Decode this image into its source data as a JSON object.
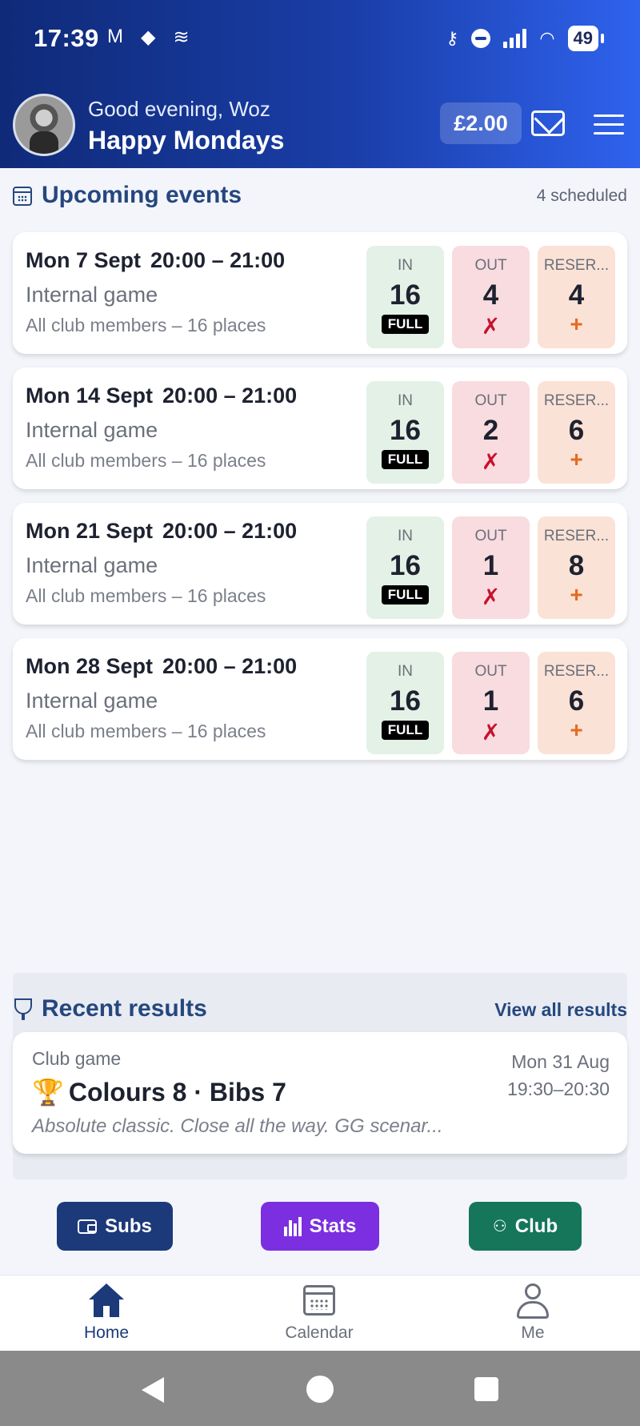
{
  "status_bar": {
    "time": "17:39",
    "battery": "49",
    "left_icons": [
      "gmail-icon",
      "diamond-icon",
      "bird-icon"
    ],
    "right_icons": [
      "key-icon",
      "dnd-icon",
      "signal-icon",
      "wifi-icon",
      "battery-icon"
    ]
  },
  "header": {
    "greeting": "Good evening, Woz",
    "club_name": "Happy Mondays",
    "balance": "£2.00"
  },
  "upcoming": {
    "title": "Upcoming events",
    "count_label": "4 scheduled",
    "labels": {
      "in": "IN",
      "out": "OUT",
      "reserve": "RESER...",
      "full": "FULL",
      "out_mark": "✗",
      "reserve_mark": "+"
    },
    "events": [
      {
        "date": "Mon 7 Sept",
        "time": "20:00 – 21:00",
        "type": "Internal game",
        "places": "All club members – 16 places",
        "in": "16",
        "out": "4",
        "reserve": "4"
      },
      {
        "date": "Mon 14 Sept",
        "time": "20:00 – 21:00",
        "type": "Internal game",
        "places": "All club members – 16 places",
        "in": "16",
        "out": "2",
        "reserve": "6"
      },
      {
        "date": "Mon 21 Sept",
        "time": "20:00 – 21:00",
        "type": "Internal game",
        "places": "All club members – 16 places",
        "in": "16",
        "out": "1",
        "reserve": "8"
      },
      {
        "date": "Mon 28 Sept",
        "time": "20:00 – 21:00",
        "type": "Internal game",
        "places": "All club members – 16 places",
        "in": "16",
        "out": "1",
        "reserve": "6"
      }
    ]
  },
  "results": {
    "title": "Recent results",
    "view_all": "View all results",
    "item": {
      "category": "Club game",
      "trophy": "🏆",
      "score": "Colours 8 · Bibs 7",
      "comment": "Absolute classic. Close all the way. GG scenar...",
      "date": "Mon 31 Aug",
      "time": "19:30–20:30"
    }
  },
  "quick_actions": {
    "subs": "Subs",
    "stats": "Stats",
    "club": "Club"
  },
  "bottom_nav": {
    "home": "Home",
    "calendar": "Calendar",
    "me": "Me"
  },
  "colors": {
    "header_start": "#0f2a78",
    "header_end": "#2f62ee",
    "accent_navy": "#1c3a7a",
    "stats_purple": "#7b2fe0",
    "club_green": "#157659",
    "in_bg": "#e4f1e6",
    "out_bg": "#f8dcdf",
    "reserve_bg": "#fbe2d6"
  }
}
